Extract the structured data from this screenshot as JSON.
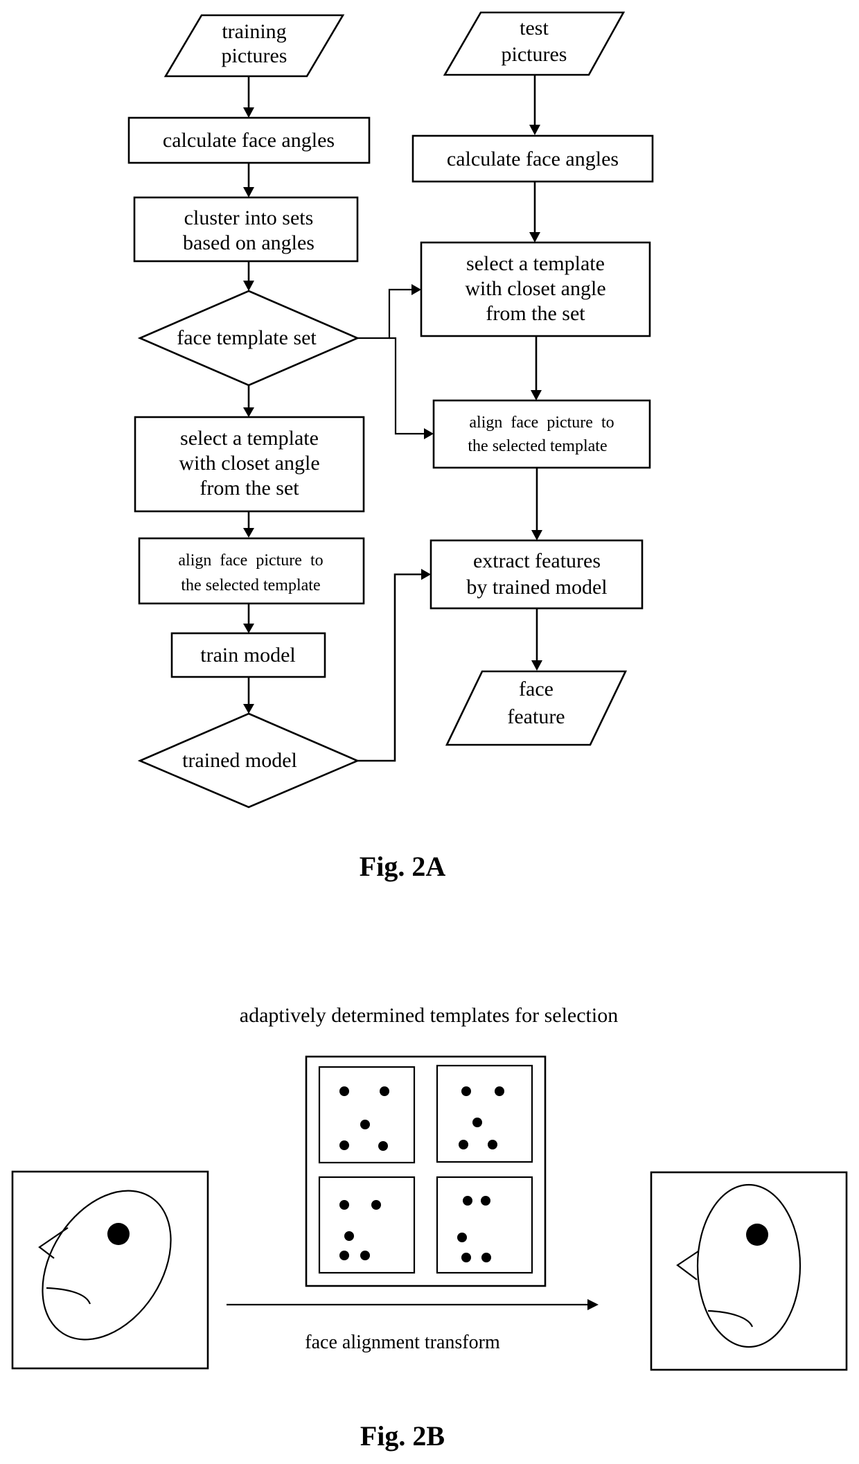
{
  "fig_2a": {
    "caption": "Fig. 2A",
    "training_branch": {
      "input": {
        "lines": [
          "training",
          "pictures"
        ]
      },
      "calculate": {
        "lines": [
          "calculate face angles"
        ]
      },
      "cluster": {
        "lines": [
          "cluster into sets",
          "based on angles"
        ]
      },
      "template_set": {
        "lines": [
          "face template set"
        ]
      },
      "select": {
        "lines": [
          "select a template",
          "with closet angle",
          "from the set"
        ]
      },
      "align": {
        "lines": [
          "align  face  picture  to",
          "the selected template"
        ]
      },
      "train": {
        "lines": [
          "train model"
        ]
      },
      "trained_model": {
        "lines": [
          "trained model"
        ]
      }
    },
    "test_branch": {
      "input": {
        "lines": [
          "test",
          "pictures"
        ]
      },
      "calculate": {
        "lines": [
          "calculate face angles"
        ]
      },
      "select": {
        "lines": [
          "select a template",
          "with closet angle",
          "from the set"
        ]
      },
      "align": {
        "lines": [
          "align  face  picture  to",
          "the selected template"
        ]
      },
      "extract": {
        "lines": [
          "extract features",
          "by trained model"
        ]
      },
      "output": {
        "lines": [
          "face",
          "feature"
        ]
      }
    }
  },
  "fig_2b": {
    "caption": "Fig. 2B",
    "templates_title": "adaptively determined templates for selection",
    "transform_label": "face alignment transform",
    "input_face": {
      "pose": "rotated",
      "icon": "face-sketch-rotated"
    },
    "output_face": {
      "pose": "frontal",
      "icon": "face-sketch-frontal"
    },
    "template_count": 4,
    "landmarks_per_template": 5
  }
}
